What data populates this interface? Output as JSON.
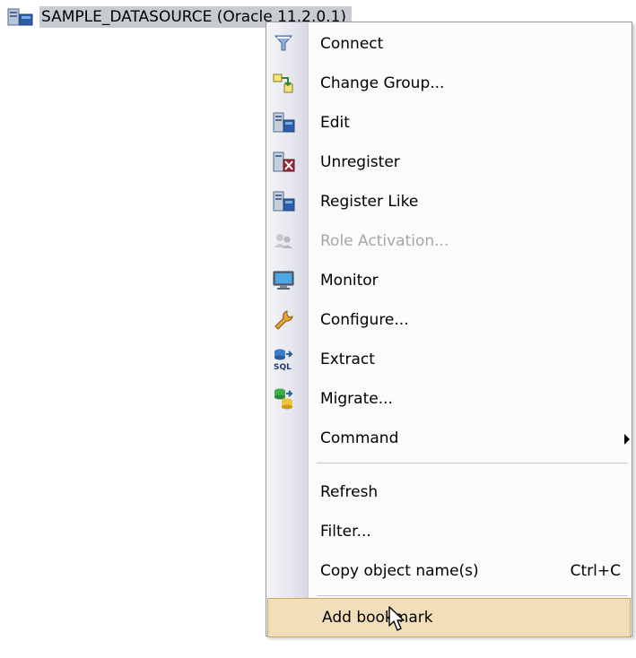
{
  "tree": {
    "node_icon": "database-node-icon",
    "node_label": "SAMPLE_DATASOURCE (Oracle 11.2.0.1)"
  },
  "menu": {
    "items": [
      {
        "label": "Connect",
        "icon": "connect-funnel-icon",
        "enabled": true
      },
      {
        "label": "Change Group...",
        "icon": "change-group-icon",
        "enabled": true
      },
      {
        "label": "Edit",
        "icon": "edit-datasource-icon",
        "enabled": true
      },
      {
        "label": "Unregister",
        "icon": "unregister-icon",
        "enabled": true
      },
      {
        "label": "Register Like",
        "icon": "register-like-icon",
        "enabled": true
      },
      {
        "label": "Role Activation...",
        "icon": "role-activation-icon",
        "enabled": false
      },
      {
        "label": "Monitor",
        "icon": "monitor-icon",
        "enabled": true
      },
      {
        "label": "Configure...",
        "icon": "wrench-icon",
        "enabled": true
      },
      {
        "label": "Extract",
        "icon": "extract-sql-icon",
        "enabled": true
      },
      {
        "label": "Migrate...",
        "icon": "migrate-icon",
        "enabled": true
      },
      {
        "label": "Command",
        "icon": "",
        "enabled": true,
        "submenu": true
      },
      {
        "label": "Refresh",
        "icon": "",
        "enabled": true
      },
      {
        "label": "Filter...",
        "icon": "",
        "enabled": true
      },
      {
        "label": "Copy object name(s)",
        "icon": "",
        "enabled": true,
        "shortcut": "Ctrl+C"
      },
      {
        "label": "Add bookmark",
        "icon": "",
        "enabled": true,
        "highlighted": true
      }
    ]
  },
  "colors": {
    "highlight": "#f2deb9",
    "highlight_border": "#c8a86a",
    "disabled_text": "#a6a6a6",
    "selection_background": "#c8cbd0"
  }
}
